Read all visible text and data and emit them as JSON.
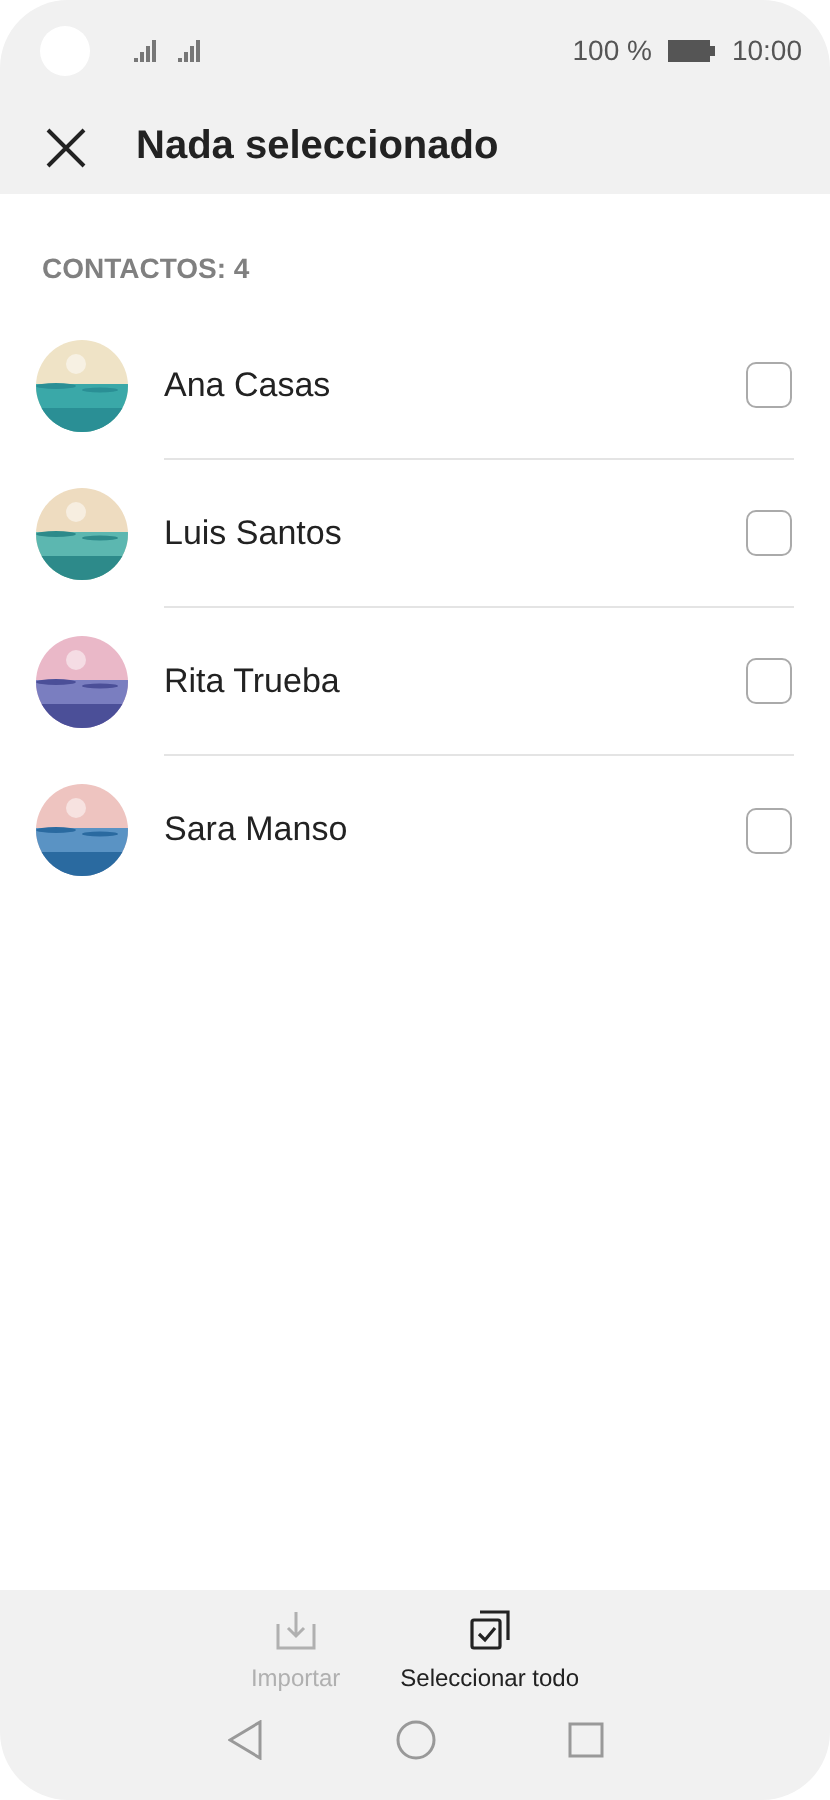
{
  "status_bar": {
    "battery": "100 %",
    "time": "10:00"
  },
  "header": {
    "title": "Nada seleccionado"
  },
  "section": {
    "label": "CONTACTOS: 4"
  },
  "contacts": [
    {
      "name": "Ana Casas",
      "checked": false
    },
    {
      "name": "Luis Santos",
      "checked": false
    },
    {
      "name": "Rita Trueba",
      "checked": false
    },
    {
      "name": "Sara Manso",
      "checked": false
    }
  ],
  "actions": [
    {
      "kind": "import",
      "label": "Importar",
      "disabled": true
    },
    {
      "kind": "select_all",
      "label": "Seleccionar todo",
      "disabled": false
    }
  ]
}
